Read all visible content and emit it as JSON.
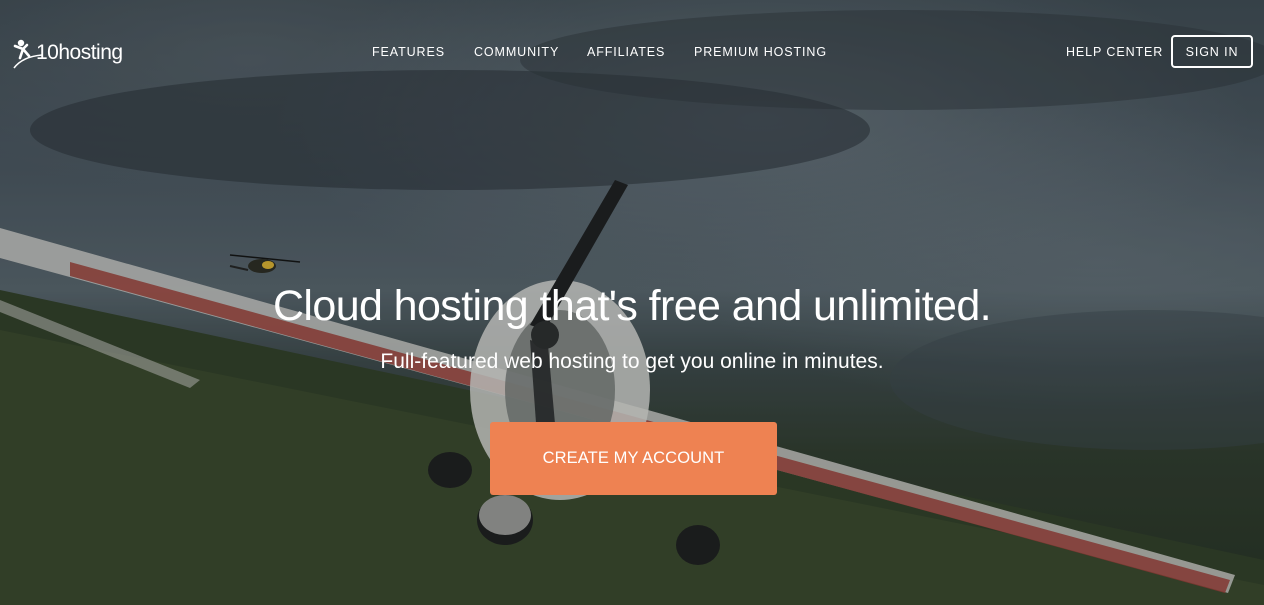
{
  "brand": {
    "logo_text": "10hosting",
    "logo_icon": "person-swoosh-icon"
  },
  "nav": {
    "items": [
      "FEATURES",
      "COMMUNITY",
      "AFFILIATES",
      "PREMIUM HOSTING"
    ],
    "help_center": "HELP CENTER",
    "sign_in": "SIGN IN"
  },
  "hero": {
    "headline": "Cloud hosting that's free and unlimited.",
    "subheadline": "Full-featured web hosting to get you online in minutes.",
    "cta_label": "CREATE MY ACCOUNT",
    "background": "airplane-on-grass-stormy-sky"
  },
  "colors": {
    "cta": "#ee8252",
    "text": "#ffffff",
    "overlay": "#2c3337"
  }
}
